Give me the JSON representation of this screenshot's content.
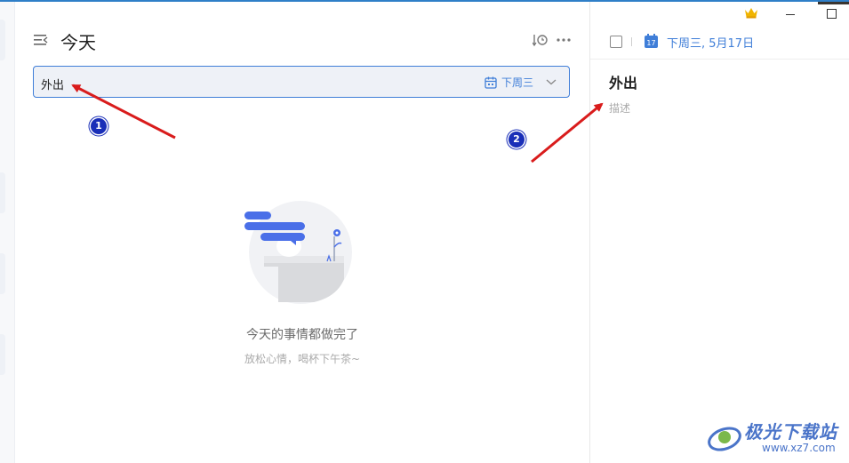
{
  "main": {
    "title": "今天",
    "task_input": {
      "value": "外出",
      "due_label": "下周三"
    },
    "empty_state": {
      "title": "今天的事情都做完了",
      "subtitle": "放松心情，喝杯下午茶~"
    }
  },
  "detail": {
    "date": "下周三, 5月17日",
    "calendar_day": "17",
    "title": "外出",
    "description_placeholder": "描述"
  },
  "annotations": {
    "badge_1": "1",
    "badge_2": "2"
  },
  "watermark": {
    "name": "极光下载站",
    "url": "www.xz7.com"
  },
  "icons": [
    "menu-icon",
    "sort-icon",
    "more-icon",
    "calendar-icon",
    "chevron-down-icon",
    "crown-icon",
    "minimize-icon",
    "maximize-icon",
    "checkbox-icon",
    "calendar-17-icon"
  ],
  "colors": {
    "accent": "#3f7ed8",
    "annotation_arrow": "#d91c1c",
    "badge": "#1a2fb8",
    "input_bg": "#eef1f7"
  }
}
